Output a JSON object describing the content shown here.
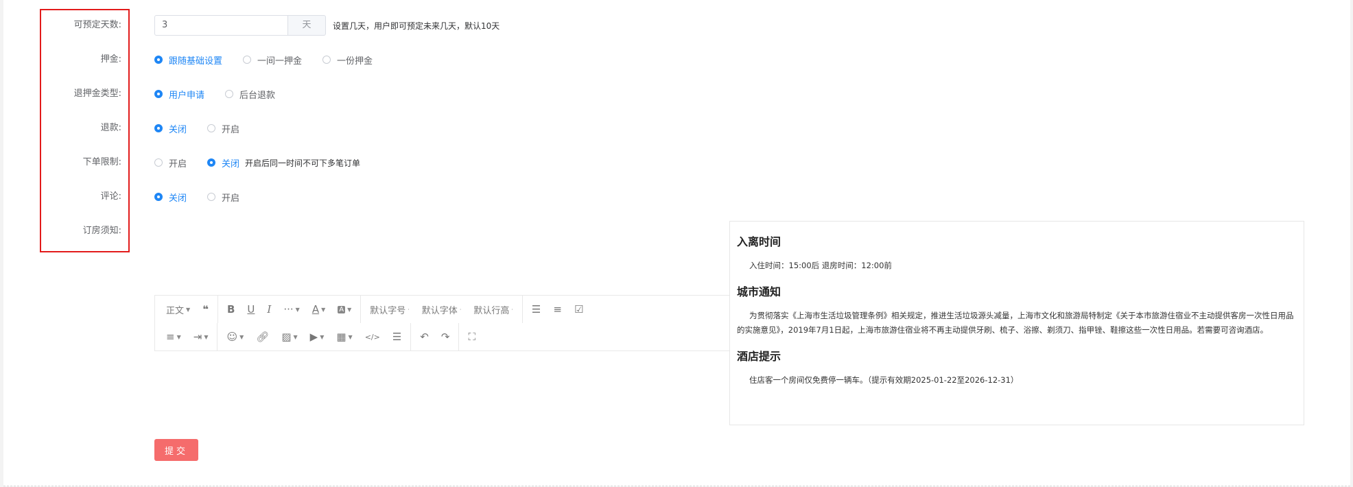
{
  "form": {
    "labels": [
      "可预定天数:",
      "押金:",
      "退押金类型:",
      "退款:",
      "下单限制:",
      "评论:",
      "订房须知:"
    ],
    "days": {
      "value": "3",
      "addon": "天",
      "hint": "设置几天，用户即可预定未来几天，默认10天"
    },
    "deposit": {
      "options": [
        "跟随基础设置",
        "一间一押金",
        "一份押金"
      ],
      "selected": 0
    },
    "refund_deposit_type": {
      "options": [
        "用户申请",
        "后台退款"
      ],
      "selected": 0
    },
    "refund": {
      "options": [
        "关闭",
        "开启"
      ],
      "selected": 0
    },
    "order_limit": {
      "options": [
        "开启",
        "关闭"
      ],
      "selected": 1,
      "hint": "开启后同一时间不可下多笔订单"
    },
    "comment": {
      "options": [
        "关闭",
        "开启"
      ],
      "selected": 0
    }
  },
  "editor": {
    "row1": {
      "paragraph": "正文",
      "font_size": "默认字号",
      "font_family": "默认字体",
      "line_height": "默认行高"
    },
    "icons": [
      "quote-icon",
      "bold-icon",
      "underline-icon",
      "italic-icon",
      "more-icon",
      "font-color-icon",
      "bg-color-icon",
      "bullet-list-icon",
      "ordered-list-icon",
      "todo-icon",
      "align-icon",
      "indent-icon",
      "emoji-icon",
      "link-icon",
      "image-icon",
      "video-icon",
      "table-icon",
      "code-icon",
      "divider-icon",
      "undo-icon",
      "redo-icon",
      "fullscreen-icon"
    ]
  },
  "preview": {
    "h1": "入离时间",
    "p1": "入住时间：15:00后 退房时间：12:00前",
    "h2": "城市通知",
    "p2": "为贯彻落实《上海市生活垃圾管理条例》相关规定，推进生活垃圾源头减量，上海市文化和旅游局特制定《关于本市旅游住宿业不主动提供客房一次性日用品的实施意见》，2019年7月1日起，上海市旅游住宿业将不再主动提供牙刷、梳子、浴擦、剃须刀、指甲锉、鞋擦这些一次性日用品。若需要可咨询酒店。",
    "h3": "酒店提示",
    "p3": "住店客一个房间仅免费停一辆车。（提示有效期2025-01-22至2026-12-31）"
  },
  "submit_label": "提交",
  "colors": {
    "primary": "#1e86f5",
    "danger": "#f56c6c",
    "highlight_border": "#e21a1a"
  }
}
